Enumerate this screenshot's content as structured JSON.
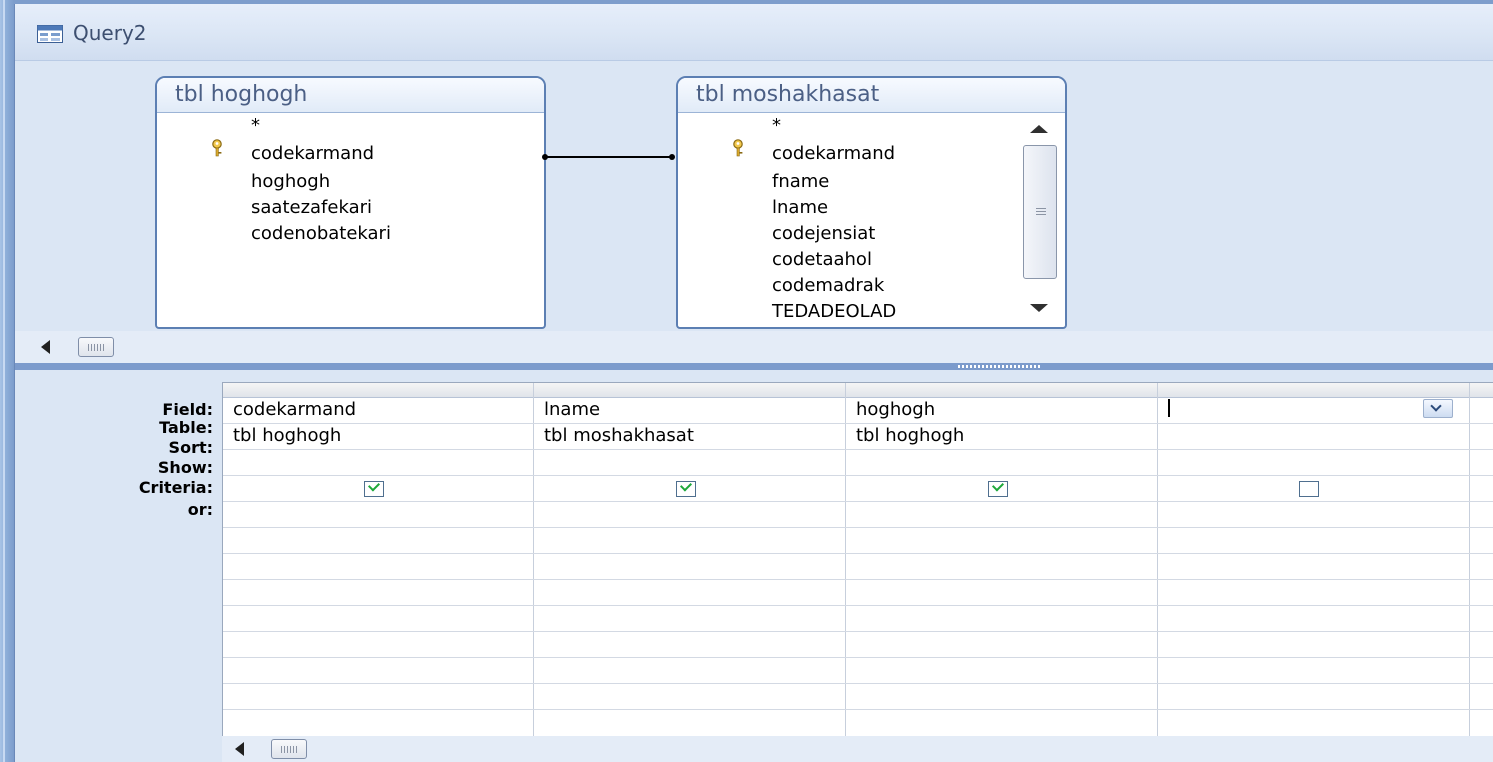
{
  "window": {
    "title": "Query2",
    "icon": "query-icon"
  },
  "tables": [
    {
      "name": "tbl hoghogh",
      "fields": [
        {
          "label": "*",
          "primary_key": false
        },
        {
          "label": "codekarmand",
          "primary_key": true
        },
        {
          "label": "hoghogh",
          "primary_key": false
        },
        {
          "label": "saatezafekari",
          "primary_key": false
        },
        {
          "label": "codenobatekari",
          "primary_key": false
        }
      ]
    },
    {
      "name": "tbl moshakhasat",
      "fields": [
        {
          "label": "*",
          "primary_key": false
        },
        {
          "label": "codekarmand",
          "primary_key": true
        },
        {
          "label": "fname",
          "primary_key": false
        },
        {
          "label": "lname",
          "primary_key": false
        },
        {
          "label": "codejensiat",
          "primary_key": false
        },
        {
          "label": "codetaahol",
          "primary_key": false
        },
        {
          "label": "codemadrak",
          "primary_key": false
        },
        {
          "label": "TEDADEOLAD",
          "primary_key": false
        }
      ]
    }
  ],
  "relationship": {
    "from": "tbl hoghogh.codekarmand",
    "to": "tbl moshakhasat.codekarmand"
  },
  "grid": {
    "row_labels": [
      "Field:",
      "Table:",
      "Sort:",
      "Show:",
      "Criteria:",
      "or:"
    ],
    "columns": [
      {
        "field": "codekarmand",
        "table": "tbl hoghogh",
        "sort": "",
        "show": true
      },
      {
        "field": "lname",
        "table": "tbl moshakhasat",
        "sort": "",
        "show": true
      },
      {
        "field": "hoghogh",
        "table": "tbl hoghogh",
        "sort": "",
        "show": true
      },
      {
        "field": "",
        "table": "",
        "sort": "",
        "show": false
      }
    ]
  },
  "icons": {
    "key": "key-icon",
    "scroll_left": "arrow-left-icon",
    "scroll_up": "arrow-up-icon",
    "scroll_down": "arrow-down-icon",
    "dropdown": "chevron-down-icon"
  },
  "colors": {
    "design_bg": "#dbe6f4",
    "table_border": "#5c7fb3",
    "check_green": "#1ea83a",
    "splitter": "#7c9bcc"
  }
}
